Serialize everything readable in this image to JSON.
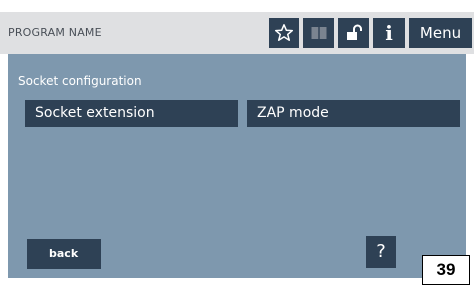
{
  "header": {
    "program_name": "PROGRAM NAME",
    "menu_label": "Menu",
    "info_label": "i"
  },
  "main": {
    "section_title": "Socket configuration",
    "options": [
      "Socket extension",
      "ZAP mode"
    ]
  },
  "footer": {
    "back_label": "back",
    "help_label": "?"
  },
  "page_number": "39",
  "icons": [
    "star-icon",
    "book-icon",
    "unlocked-padlock-icon"
  ],
  "colors": {
    "header_bg": "#dfe0e2",
    "button_bg": "#2e4155",
    "panel_bg": "#7e98ae",
    "text_light": "#ffffff"
  }
}
